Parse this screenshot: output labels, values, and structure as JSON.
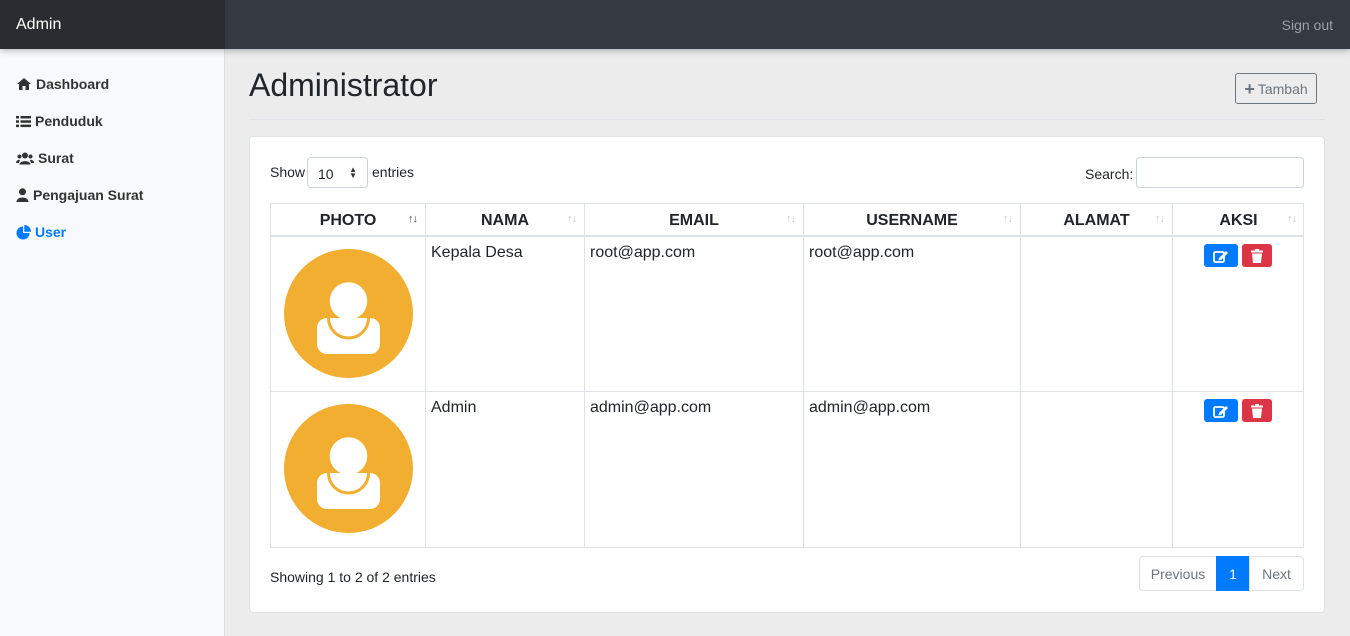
{
  "app": {
    "brand": "Admin",
    "signout": "Sign out"
  },
  "sidebar": {
    "items": [
      {
        "label": "Dashboard",
        "icon": "home-icon",
        "active": false
      },
      {
        "label": "Penduduk",
        "icon": "list-icon",
        "active": false
      },
      {
        "label": "Surat",
        "icon": "users-icon",
        "active": false
      },
      {
        "label": "Pengajuan Surat",
        "icon": "user-icon",
        "active": false
      },
      {
        "label": "User",
        "icon": "chart-pie-icon",
        "active": true
      }
    ]
  },
  "page": {
    "title": "Administrator",
    "add_button": "Tambah"
  },
  "table": {
    "length_label": "Show",
    "length_value": "10",
    "length_suffix": "entries",
    "search_label": "Search:",
    "search_value": "",
    "columns": [
      "PHOTO",
      "NAMA",
      "EMAIL",
      "USERNAME",
      "ALAMAT",
      "AKSI"
    ],
    "rows": [
      {
        "nama": "Kepala Desa",
        "email": "root@app.com",
        "username": "root@app.com",
        "alamat": ""
      },
      {
        "nama": "Admin",
        "email": "admin@app.com",
        "username": "admin@app.com",
        "alamat": ""
      }
    ],
    "info": "Showing 1 to 2 of 2 entries",
    "pagination": {
      "previous": "Previous",
      "current": "1",
      "next": "Next"
    }
  },
  "colors": {
    "accent": "#007bff",
    "danger": "#dc3545",
    "avatar": "#f2ae30",
    "topbar": "#343a40"
  }
}
